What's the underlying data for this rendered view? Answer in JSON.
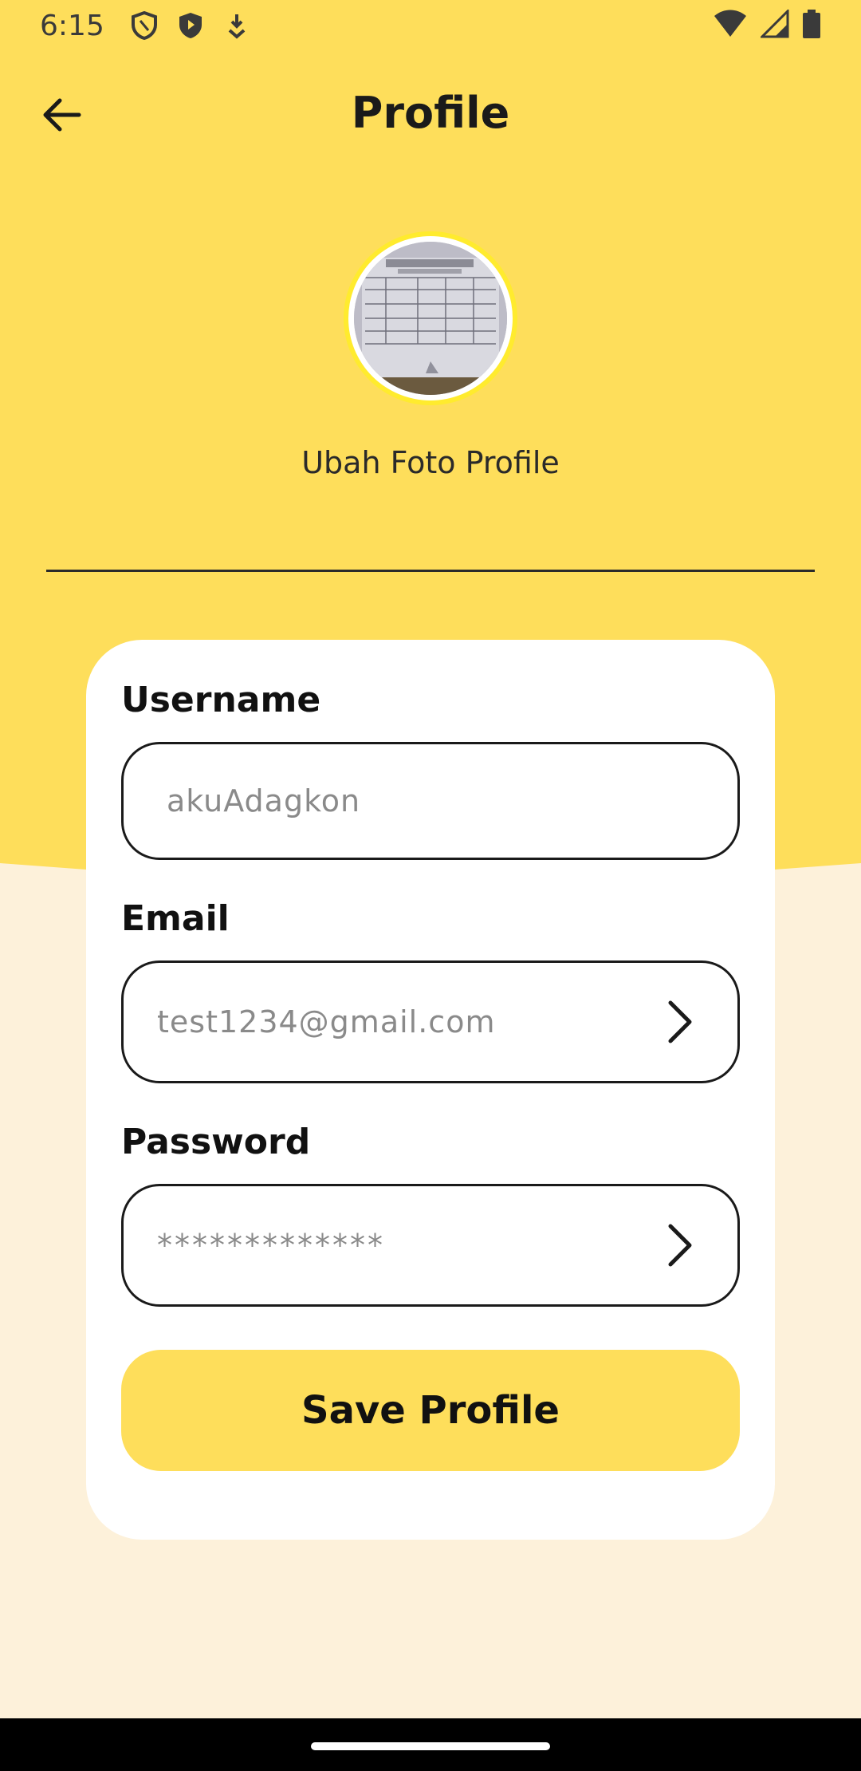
{
  "status_bar": {
    "time": "6:15",
    "left_icons": [
      "shield-outline-icon",
      "shield-filled-icon",
      "download-icon"
    ],
    "right_icons": [
      "wifi-icon",
      "signal-icon",
      "battery-icon"
    ]
  },
  "header": {
    "title": "Profile",
    "back_icon": "arrow-left-icon"
  },
  "profile_photo": {
    "change_label": "Ubah Foto Profile"
  },
  "form": {
    "username": {
      "label": "Username",
      "value": "akuAdagkon"
    },
    "email": {
      "label": "Email",
      "value": "test1234@gmail.com"
    },
    "password": {
      "label": "Password",
      "value": "*************"
    },
    "save_label": "Save Profile"
  },
  "colors": {
    "accent": "#FEDE5B",
    "background": "#FDF1DA",
    "card": "#FFFFFF",
    "text": "#111111",
    "placeholder": "#8A8A8A"
  }
}
